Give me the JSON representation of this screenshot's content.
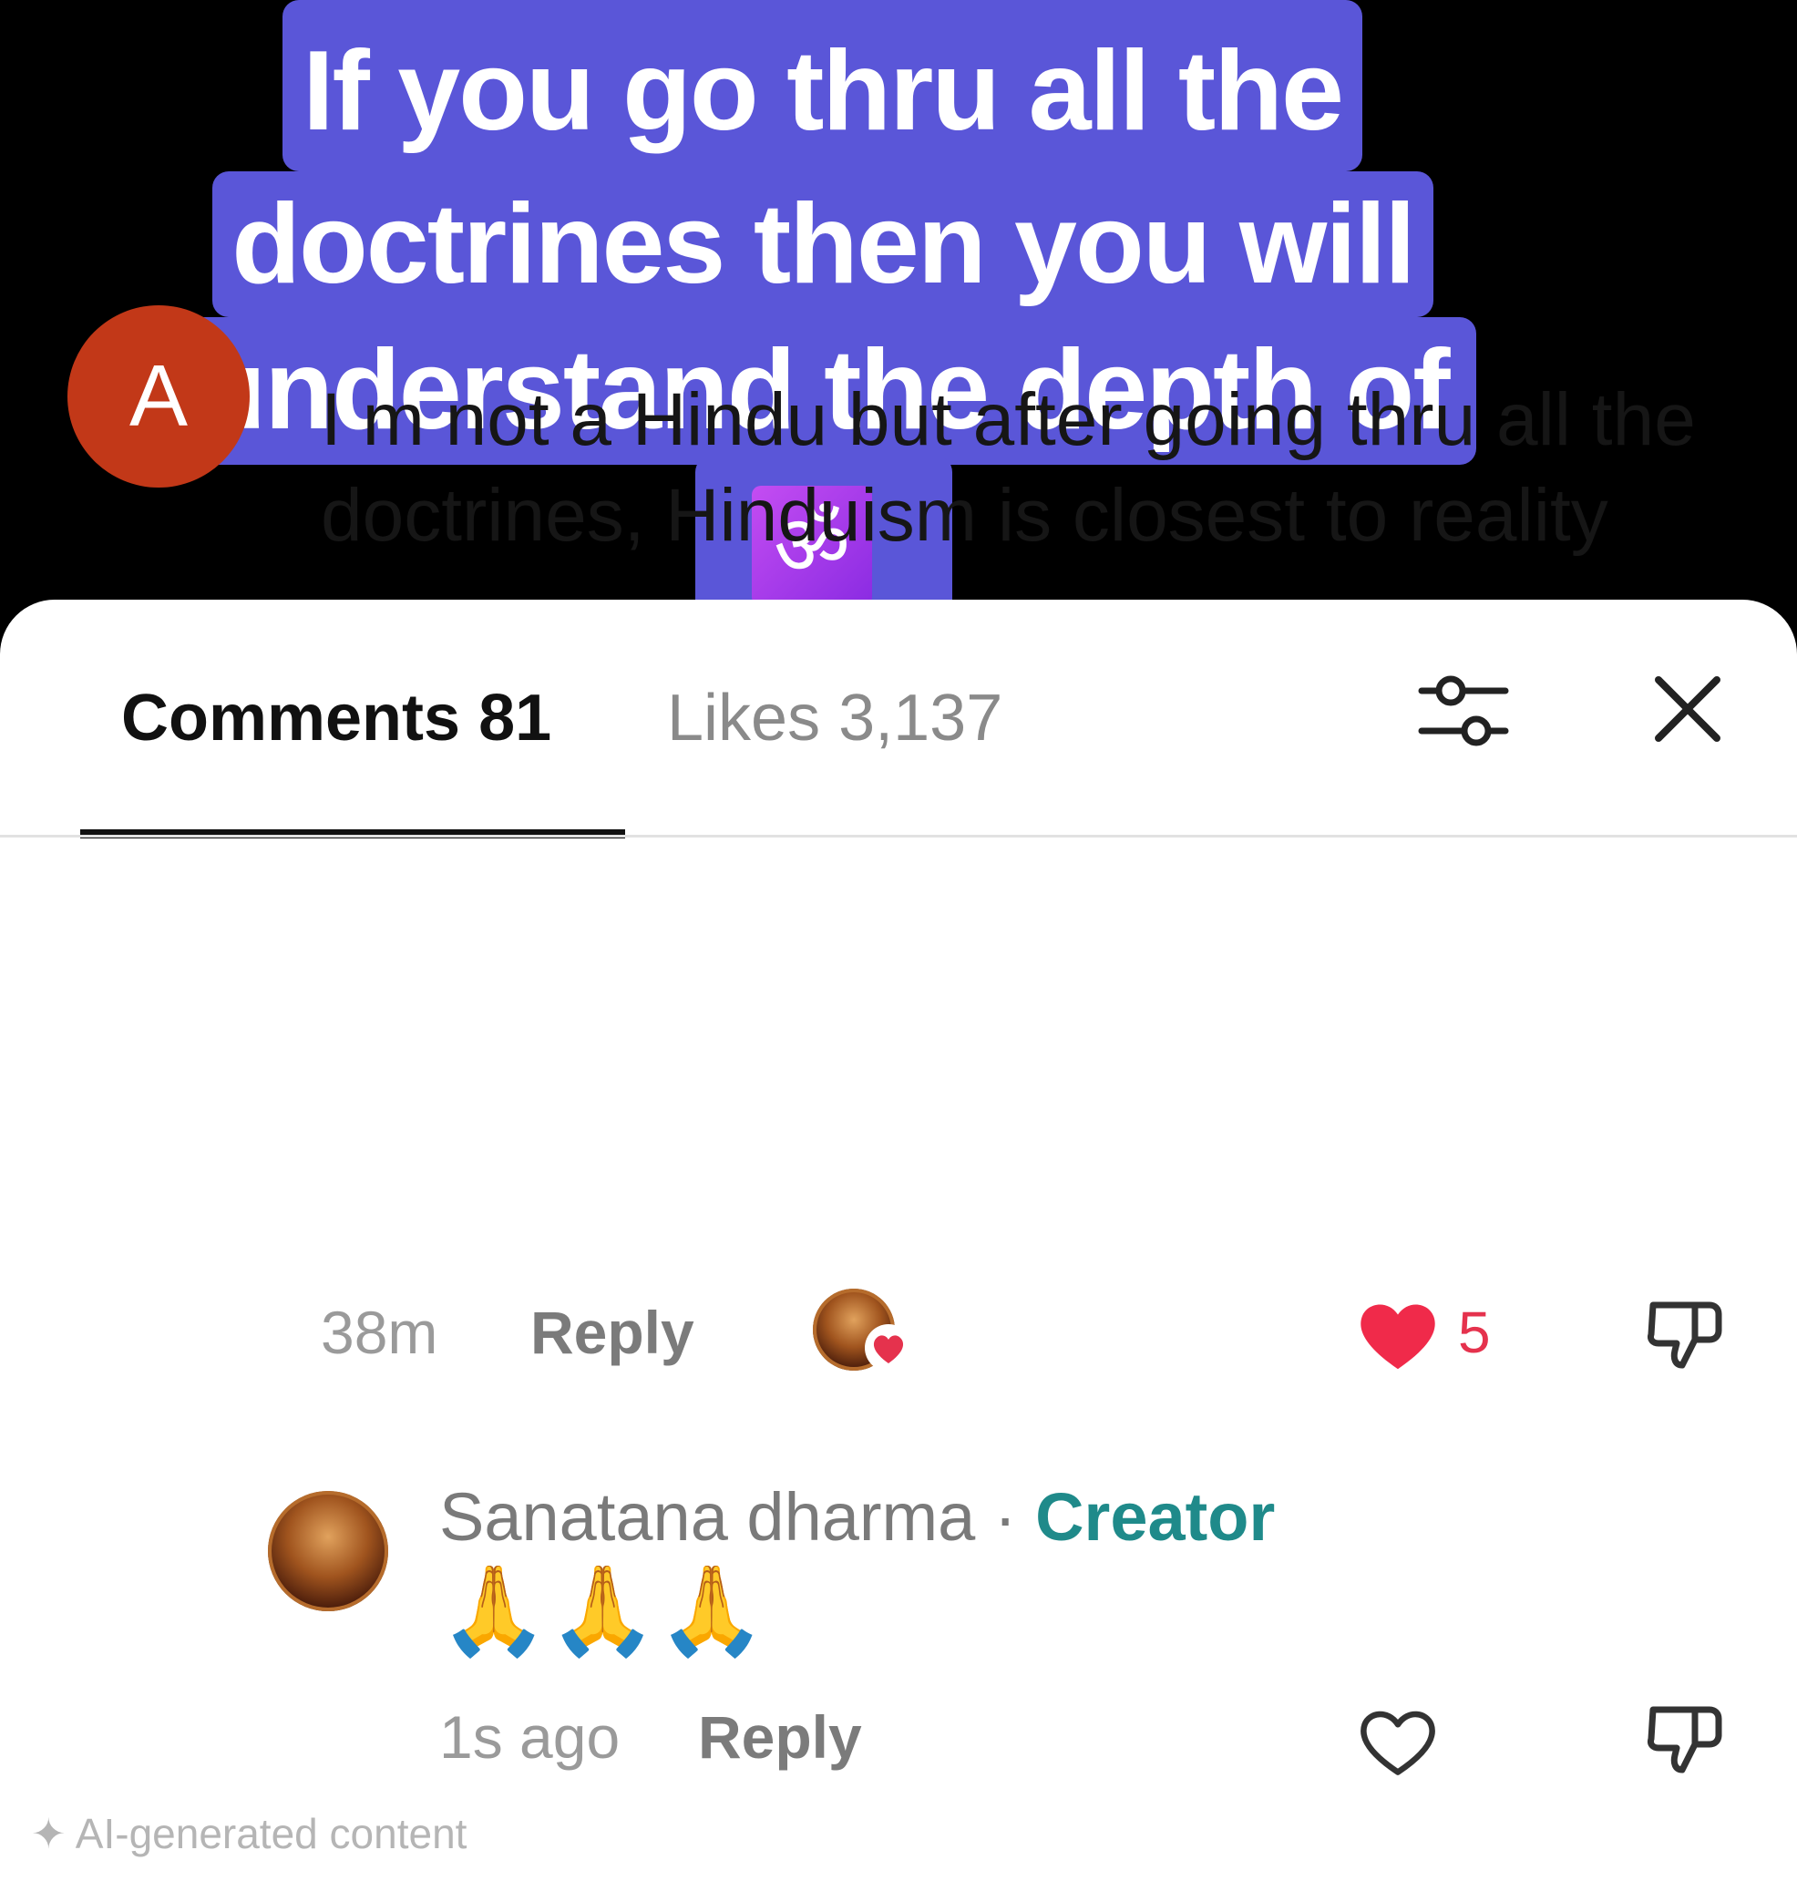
{
  "video": {
    "caption_lines": [
      "If you go thru all the",
      "doctrines then you will",
      "understand the depth of"
    ],
    "caption_emoji": "ॐ"
  },
  "tabs": {
    "comments_label": "Comments 81",
    "likes_label": "Likes 3,137"
  },
  "comment": {
    "avatar_letter": "A",
    "text": "I m not a Hindu but after going thru all the doctrines, Hinduism is closest to reality",
    "time": "38m",
    "reply_label": "Reply",
    "like_count": "5"
  },
  "reply": {
    "author": "Sanatana dharma",
    "separator": "·",
    "badge": "Creator",
    "text": "🙏🙏🙏",
    "time": "1s ago",
    "reply_label": "Reply"
  },
  "footer": {
    "ai_label": "AI-generated content"
  },
  "colors": {
    "caption_bg": "#5a56d8",
    "avatar_a": "#c23818",
    "like_red": "#e5324d",
    "creator_teal": "#1f8a8a"
  }
}
